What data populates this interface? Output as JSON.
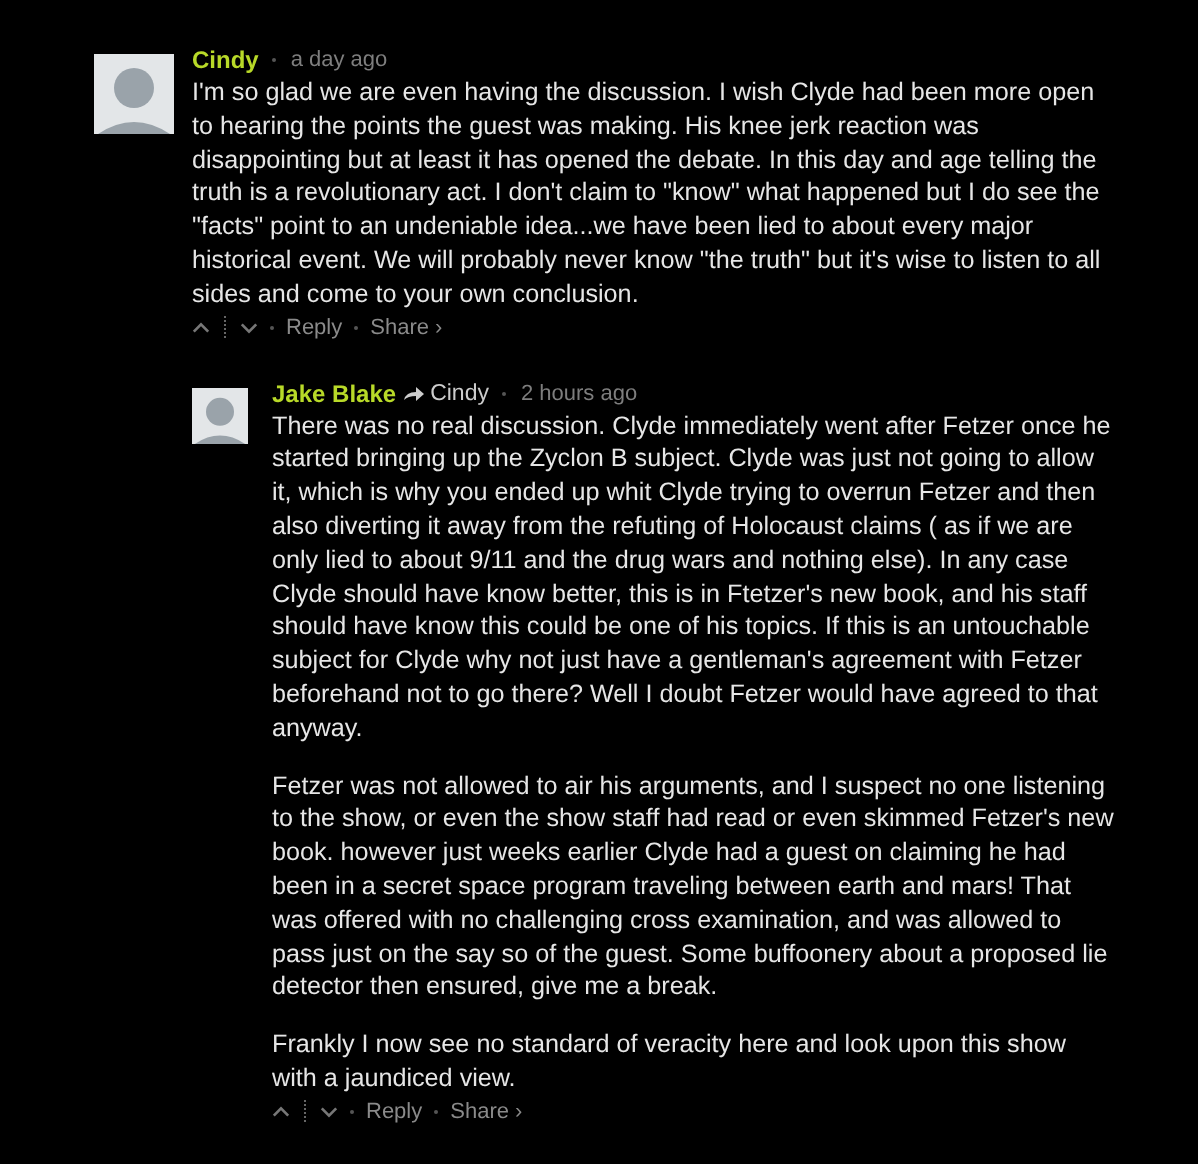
{
  "comments": [
    {
      "author": "Cindy",
      "time": "a day ago",
      "paragraphs": [
        "I'm so glad we are even having the discussion. I wish Clyde had been more open to hearing the points the guest was making. His knee jerk reaction was disappointing but at least it has opened the debate. In this day and age telling the truth is a revolutionary act. I don't claim to \"know\" what happened but I do see the \"facts\" point to an undeniable idea...we have been lied to about every major historical event. We will probably never know \"the truth\" but it's wise to listen to all sides and come to your own conclusion."
      ],
      "actions": [
        "Reply",
        "Share ›"
      ],
      "children": [
        {
          "author": "Jake Blake",
          "reply_to": "Cindy",
          "time": "2 hours ago",
          "paragraphs": [
            "There was no real discussion. Clyde immediately went after Fetzer once he started bringing up the Zyclon B subject. Clyde was just not going to allow it, which is why you ended up whit Clyde trying to overrun Fetzer and then also diverting it away from the refuting of Holocaust claims ( as if we are only lied to about 9/11 and the drug wars and nothing else). In any case Clyde should have know better, this is in Ftetzer's new book, and his staff should have know this could be one of his topics. If this is an untouchable subject for Clyde why not just have a gentleman's agreement with Fetzer beforehand not to go there? Well I doubt Fetzer would have agreed to that anyway.",
            "Fetzer was not allowed to air his arguments, and I suspect no one listening to the show, or even the show staff had read or even skimmed Fetzer's new book. however just weeks earlier Clyde had a guest on claiming he had been in a secret space program traveling between earth and mars! That was offered with no challenging cross examination, and was allowed to pass just on the say so of the guest. Some buffoonery about a proposed lie detector then ensured, give me a break.",
            "Frankly I now see no standard of veracity here and look upon this show with a jaundiced view."
          ],
          "actions": [
            "Reply",
            "Share ›"
          ]
        }
      ]
    }
  ]
}
